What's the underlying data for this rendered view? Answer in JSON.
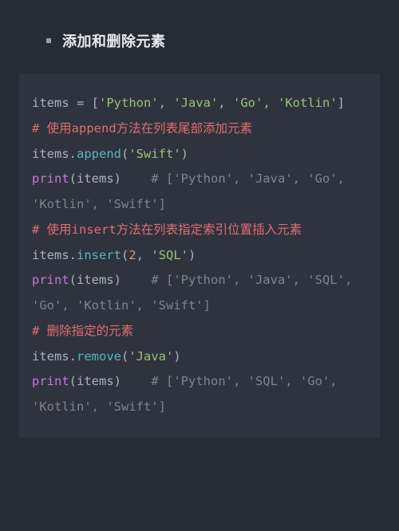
{
  "heading": "添加和删除元素",
  "code": {
    "l1": {
      "a": "items ",
      "b": "=",
      "c": " [",
      "d": "'Python'",
      "e": ", ",
      "f": "'Java'",
      "g": ", ",
      "h": "'Go'",
      "i": ", ",
      "j": "'Kotlin'",
      "k": "]"
    },
    "l2": "# 使用append方法在列表尾部添加元素",
    "l3": {
      "a": "items.",
      "b": "append",
      "c": "(",
      "d": "'Swift'",
      "e": ")"
    },
    "l4": {
      "a": "print",
      "b": "(items)    ",
      "c": "# ['Python', 'Java', 'Go', 'Kotlin', 'Swift']"
    },
    "l5": "# 使用insert方法在列表指定索引位置插入元素",
    "l6": {
      "a": "items.",
      "b": "insert",
      "c": "(",
      "d": "2",
      "e": ", ",
      "f": "'SQL'",
      "g": ")"
    },
    "l7": {
      "a": "print",
      "b": "(items)    ",
      "c": "# ['Python', 'Java', 'SQL', 'Go', 'Kotlin', 'Swift']"
    },
    "l8": "# 删除指定的元素",
    "l9": {
      "a": "items.",
      "b": "remove",
      "c": "(",
      "d": "'Java'",
      "e": ")"
    },
    "l10": {
      "a": "print",
      "b": "(items)    ",
      "c": "# ['Python', 'SQL', 'Go', 'Kotlin', 'Swift']"
    }
  }
}
